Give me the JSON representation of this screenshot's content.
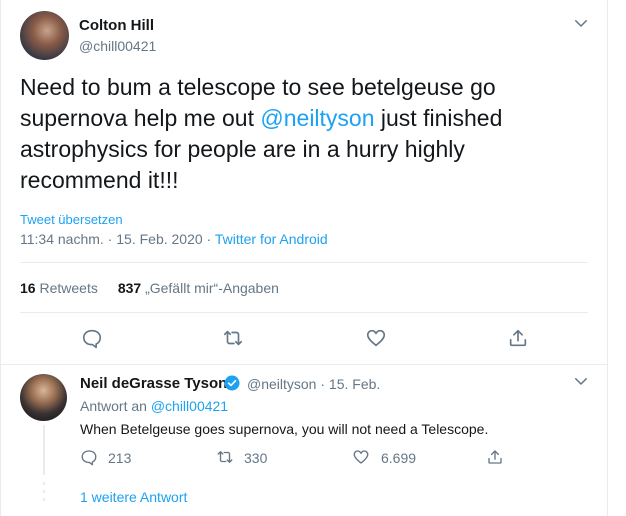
{
  "main_tweet": {
    "author_name": "Colton Hill",
    "author_handle": "@chill00421",
    "text_before": "Need to bum a telescope to see betelgeuse go supernova help me out ",
    "mention": "@neiltyson",
    "text_after": " just finished astrophysics for people are in a hurry highly recommend it!!!",
    "translate_label": "Tweet übersetzen",
    "time": "11:34 nachm.",
    "date": "15. Feb. 2020",
    "separator": "·",
    "source": "Twitter for Android",
    "retweets_count": "16",
    "retweets_label": "Retweets",
    "likes_count": "837",
    "likes_label": "„Gefällt mir“-Angaben"
  },
  "reply": {
    "author_name": "Neil deGrasse Tyson",
    "author_handle": "@neiltyson",
    "separator": "·",
    "date": "15. Feb.",
    "reply_to_prefix": "Antwort an",
    "reply_to_handle": "@chill00421",
    "text": "When Betelgeuse goes supernova, you will not need a Telescope.",
    "reply_count": "213",
    "retweet_count": "330",
    "like_count": "6.699",
    "more_replies_label": "1 weitere Antwort"
  },
  "icons": {
    "caret": "chevron-down-icon",
    "reply": "reply-icon",
    "retweet": "retweet-icon",
    "like": "heart-icon",
    "share": "share-icon",
    "verified": "verified-badge-icon"
  },
  "colors": {
    "accent": "#1da1f2",
    "text": "#14171a",
    "muted": "#657786",
    "border": "#e6ecf0"
  }
}
